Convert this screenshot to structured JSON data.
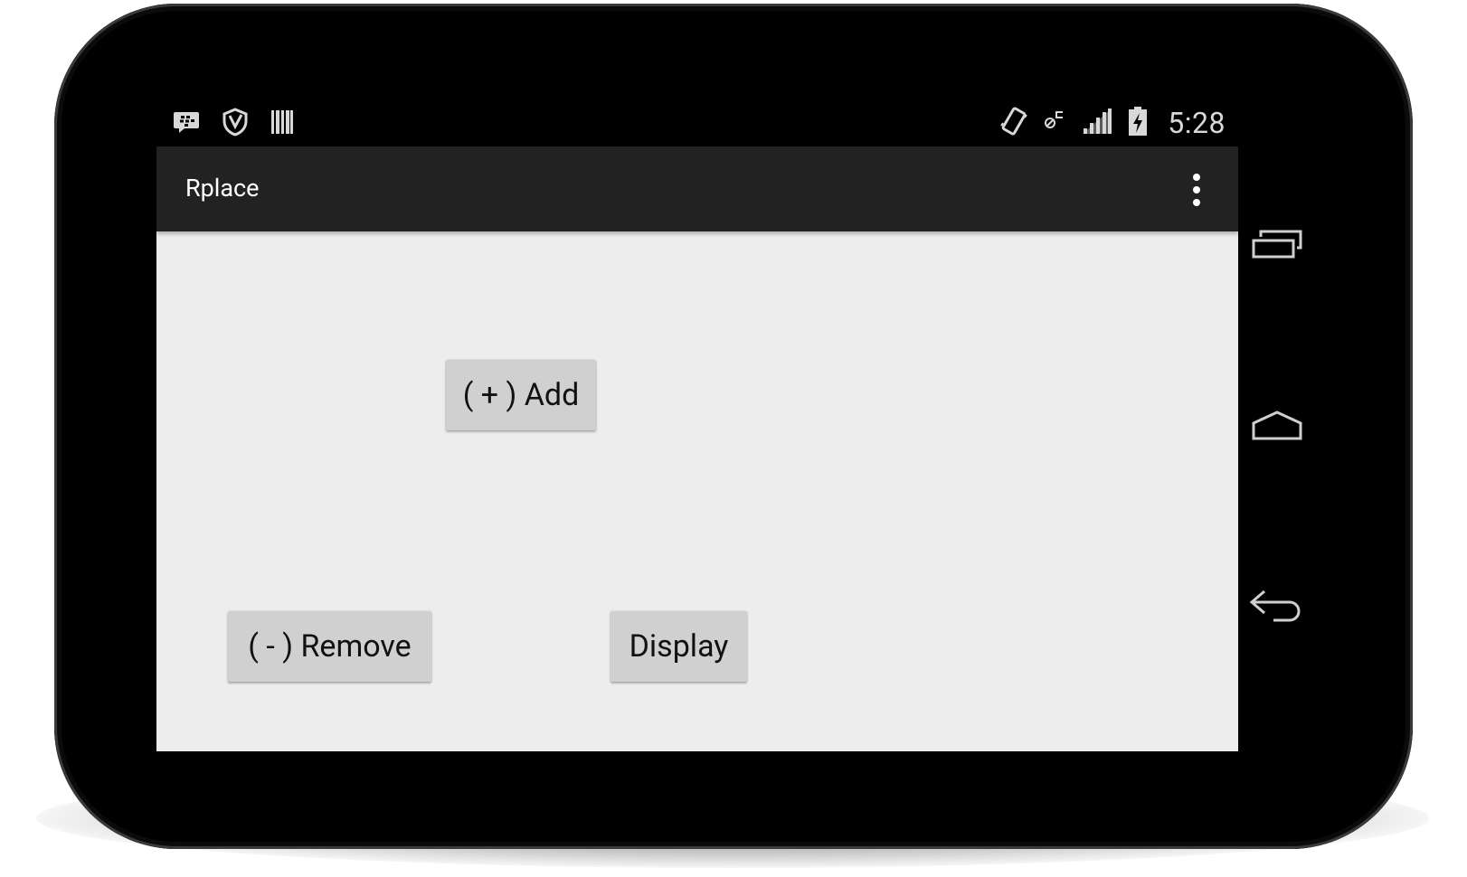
{
  "status_bar": {
    "left_icons": [
      "bbm-notification-icon",
      "security-shield-icon",
      "barcode-icon"
    ],
    "right_icons": [
      "vibrate-icon",
      "no-sim-icon",
      "signal-icon",
      "battery-charging-icon"
    ],
    "time": "5:28"
  },
  "action_bar": {
    "title": "Rplace",
    "overflow_icon": "overflow-menu-icon"
  },
  "buttons": {
    "add_label": "( + ) Add",
    "remove_label": "( - ) Remove",
    "display_label": "Display"
  },
  "navigation": {
    "icons": [
      "recents-icon",
      "home-icon",
      "back-icon"
    ]
  },
  "colors": {
    "screen_background": "#ededed",
    "action_bar": "#222222",
    "button": "#d0d0d0",
    "device_bezel": "#000000"
  }
}
